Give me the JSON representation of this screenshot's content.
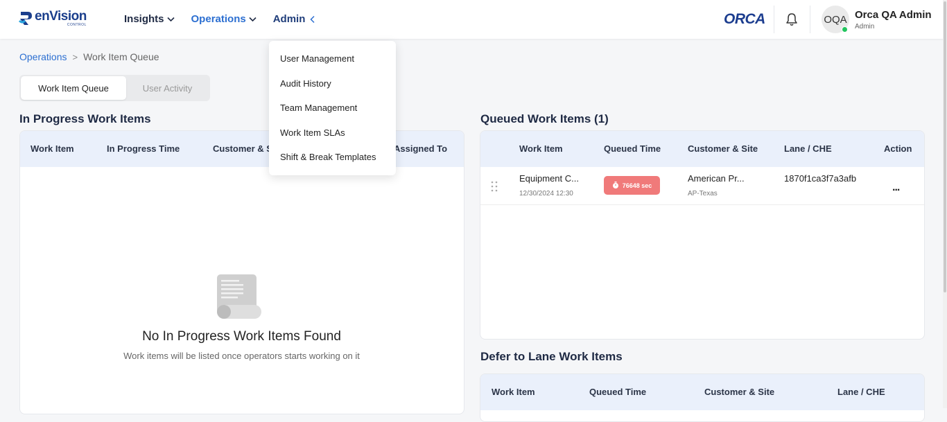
{
  "brand": {
    "logo_text": "enVision",
    "logo_subtext": "CONTROL",
    "product": "ORCA"
  },
  "nav": [
    {
      "label": "Insights",
      "active": false
    },
    {
      "label": "Operations",
      "active": true
    },
    {
      "label": "Admin",
      "active": false
    }
  ],
  "user": {
    "initials": "OQA",
    "name": "Orca QA Admin",
    "role": "Admin",
    "status_color": "#22c55e"
  },
  "breadcrumb": {
    "root": "Operations",
    "separator": ">",
    "current": "Work Item Queue"
  },
  "tabs": [
    {
      "label": "Work Item Queue",
      "active": true
    },
    {
      "label": "User Activity",
      "active": false
    }
  ],
  "admin_menu": [
    "User Management",
    "Audit History",
    "Team Management",
    "Work Item SLAs",
    "Shift & Break Templates"
  ],
  "in_progress": {
    "title": "In Progress Work Items",
    "columns": [
      "Work Item",
      "In Progress Time",
      "Customer & Site",
      "Assigned To"
    ],
    "empty_title": "No In Progress Work Items Found",
    "empty_subtitle": "Work items will be listed once operators starts working on it"
  },
  "queued": {
    "title": "Queued Work Items (1)",
    "columns": [
      "Work Item",
      "Queued Time",
      "Customer & Site",
      "Lane / CHE",
      "Action"
    ],
    "rows": [
      {
        "work_item": "Equipment C...",
        "timestamp": "12/30/2024 12:30",
        "queued_time": "76648 sec",
        "customer": "American Pr...",
        "site": "AP-Texas",
        "lane": "1870f1ca3f7a3afb",
        "action": "..."
      }
    ]
  },
  "defer": {
    "title": "Defer to Lane Work Items",
    "columns": [
      "Work Item",
      "Queued Time",
      "Customer & Site",
      "Lane / CHE"
    ]
  },
  "colors": {
    "accent": "#2c6fd1",
    "brand": "#1a3e8c",
    "header_bg": "#eaf0fb",
    "badge": "#f07a7a"
  }
}
